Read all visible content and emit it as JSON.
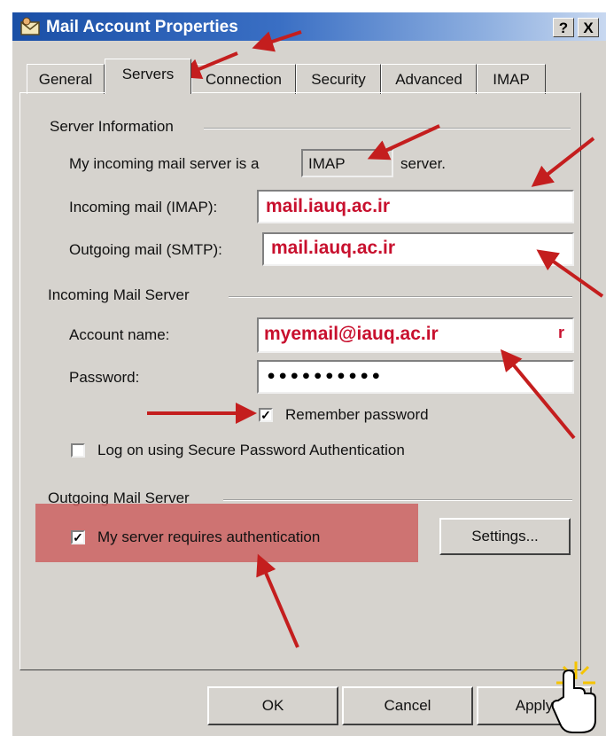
{
  "window": {
    "title": "Mail Account Properties",
    "help_button": "?",
    "close_button": "X"
  },
  "tabs": [
    {
      "label": "General",
      "active": false
    },
    {
      "label": "Servers",
      "active": true
    },
    {
      "label": "Connection",
      "active": false
    },
    {
      "label": "Security",
      "active": false
    },
    {
      "label": "Advanced",
      "active": false
    },
    {
      "label": "IMAP",
      "active": false
    }
  ],
  "server_information": {
    "group_label": "Server Information",
    "incoming_type_prefix": "My incoming mail server is a",
    "incoming_type_value": "IMAP",
    "incoming_type_suffix": "server.",
    "incoming_label": "Incoming mail (IMAP):",
    "incoming_value": "mail.iauq.ac.ir",
    "outgoing_label": "Outgoing mail (SMTP):",
    "outgoing_value": "mail.iauq.ac.ir"
  },
  "incoming_mail_server": {
    "group_label": "Incoming Mail Server",
    "account_label": "Account name:",
    "account_value": "myemail@iauq.ac.ir",
    "account_tail": "r",
    "password_label": "Password:",
    "password_value": "••••••••••",
    "remember_label": "Remember password",
    "remember_checked": true,
    "spa_label": "Log on using Secure Password Authentication",
    "spa_checked": false
  },
  "outgoing_mail_server": {
    "group_label": "Outgoing Mail Server",
    "auth_label": "My server requires authentication",
    "auth_checked": true,
    "settings_button": "Settings..."
  },
  "footer": {
    "ok_button": "OK",
    "cancel_button": "Cancel",
    "apply_button": "Apply"
  },
  "colors": {
    "field_text": "#c8102e",
    "arrow": "#c41e1e",
    "highlight": "#cd6262",
    "dialog_face": "#d6d3ce",
    "title_gradient_start": "#1a4fa6"
  }
}
